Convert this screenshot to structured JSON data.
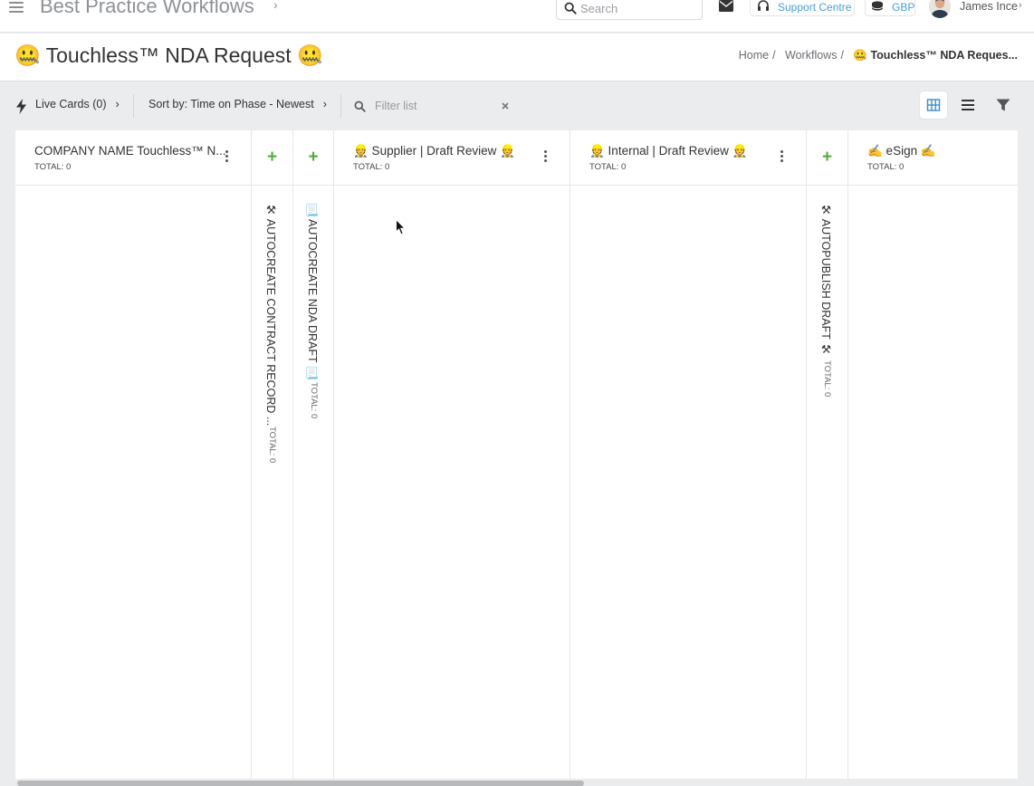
{
  "app": {
    "title": "Best Practice Workflows",
    "search_placeholder": "Search",
    "support_label": "Support Centre",
    "currency": "GBP",
    "user_name": "James Ince"
  },
  "page": {
    "title": "🤐 Touchless™ NDA Request 🤐",
    "breadcrumb": {
      "home": "Home",
      "workflows": "Workflows",
      "current": "🤐 Touchless™ NDA Reques..."
    }
  },
  "toolbar": {
    "live_cards": "Live Cards (0)",
    "sort": "Sort by: Time on Phase - Newest",
    "filter_placeholder": "Filter list"
  },
  "columns": [
    {
      "title": "COMPANY NAME Touchless™ N...",
      "total": "TOTAL: 0"
    },
    {
      "title": "👷 Supplier | Draft Review 👷",
      "total": "TOTAL: 0"
    },
    {
      "title": "👷 Internal | Draft Review 👷",
      "total": "TOTAL: 0"
    },
    {
      "title": "✍️ eSign ✍️",
      "total": "TOTAL: 0"
    }
  ],
  "automations": [
    {
      "label": "⚒ AUTOCREATE CONTRACT RECORD ...",
      "total": "TOTAL: 0"
    },
    {
      "label": "📃 AUTOCREATE NDA DRAFT 📃",
      "total": "TOTAL: 0"
    },
    {
      "label": "⚒ AUTOPUBLISH DRAFT ⚒",
      "total": "TOTAL: 0"
    }
  ],
  "colors": {
    "accent_blue": "#4a9fd6",
    "add_green": "#4caf3a"
  }
}
